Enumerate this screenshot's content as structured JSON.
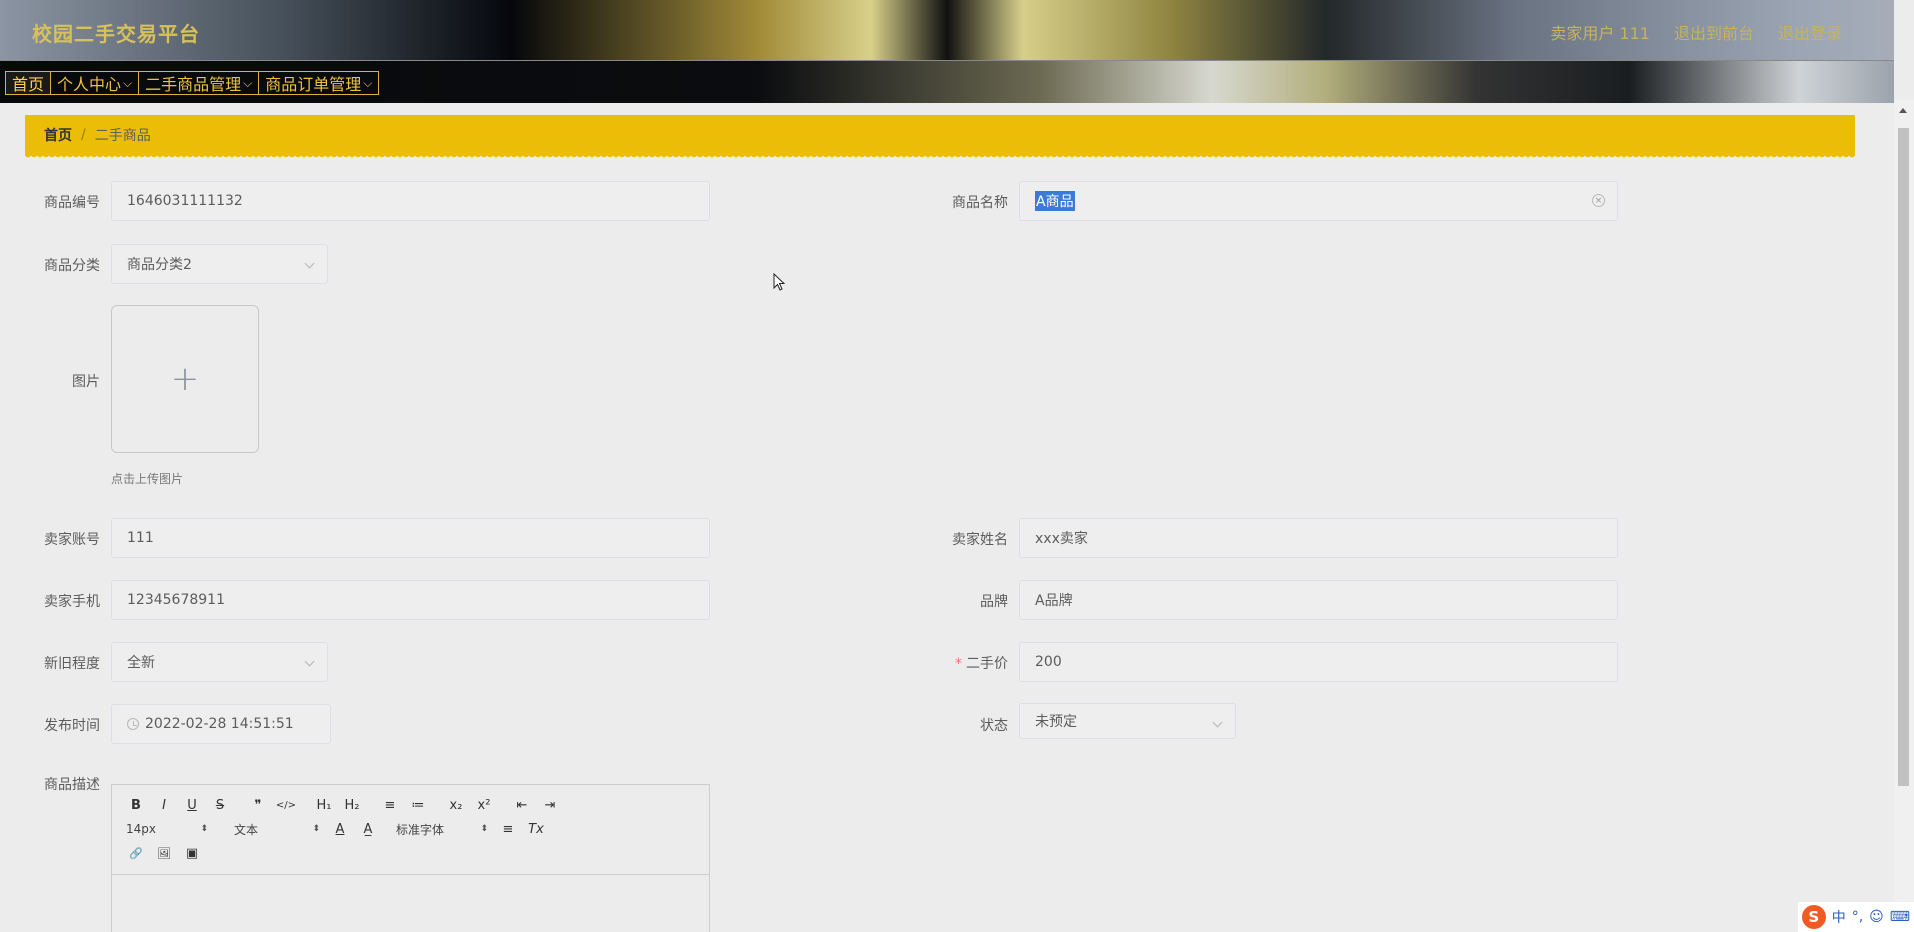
{
  "app": {
    "title": "校园二手交易平台"
  },
  "user_area": {
    "user_label": "卖家用户 111",
    "back_label": "退出到前台",
    "logout_label": "退出登录"
  },
  "nav": [
    {
      "label": "首页"
    },
    {
      "label": "个人中心"
    },
    {
      "label": "二手商品管理"
    },
    {
      "label": "商品订单管理"
    }
  ],
  "breadcrumb": {
    "home": "首页",
    "sep": "/",
    "current": "二手商品"
  },
  "form": {
    "code": {
      "label": "商品编号",
      "value": "1646031111132"
    },
    "name": {
      "label": "商品名称",
      "value": "A商品"
    },
    "category": {
      "label": "商品分类",
      "value": "商品分类2"
    },
    "image": {
      "label": "图片",
      "plus": "+",
      "tip": "点击上传图片"
    },
    "seller_account": {
      "label": "卖家账号",
      "value": "111"
    },
    "seller_name": {
      "label": "卖家姓名",
      "value": "xxx卖家"
    },
    "seller_phone": {
      "label": "卖家手机",
      "value": "12345678911"
    },
    "brand": {
      "label": "品牌",
      "value": "A品牌"
    },
    "condition": {
      "label": "新旧程度",
      "value": "全新"
    },
    "price": {
      "label": "二手价",
      "required_mark": "*",
      "value": "200"
    },
    "publish_time": {
      "label": "发布时间",
      "value": "2022-02-28 14:51:51"
    },
    "status": {
      "label": "状态",
      "value": "未预定"
    },
    "description": {
      "label": "商品描述"
    }
  },
  "editor_toolbar": {
    "row1": [
      "B",
      "I",
      "U",
      "S",
      "❞",
      "</>",
      "H₁",
      "H₂",
      "≡",
      "≔",
      "x₂",
      "x²",
      "⇤",
      "⇥"
    ],
    "font_size": "14px",
    "header_type": "文本",
    "font_family": "标准字体",
    "row2_icons": [
      "A",
      "A̲",
      "≡",
      "Tx"
    ],
    "row3": [
      "🔗",
      "🖼",
      "▣"
    ]
  },
  "ime": {
    "lang": "中",
    "punct": "°,",
    "smile": "☺",
    "kbd": "⌨"
  }
}
